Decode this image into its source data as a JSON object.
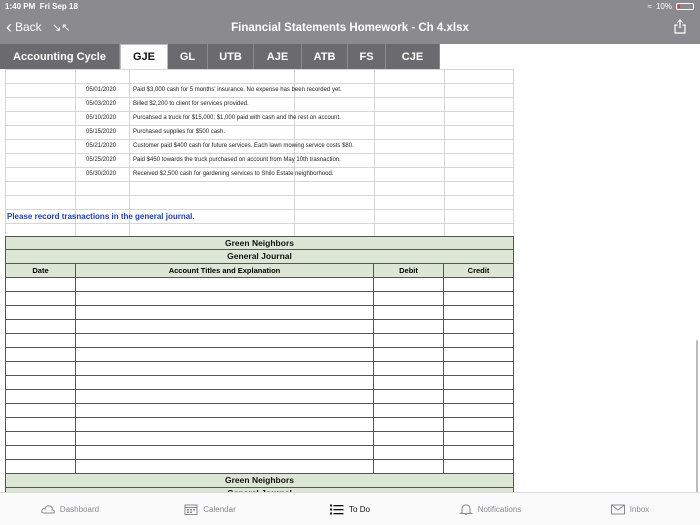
{
  "status": {
    "time": "1:40 PM",
    "date": "Fri Sep 18",
    "battery": "10%"
  },
  "nav": {
    "back_label": "Back",
    "title": "Financial Statements Homework - Ch 4.xlsx"
  },
  "tabs": [
    {
      "label": "Accounting Cycle",
      "active": false
    },
    {
      "label": "GJE",
      "active": true
    },
    {
      "label": "GL",
      "active": false
    },
    {
      "label": "UTB",
      "active": false
    },
    {
      "label": "AJE",
      "active": false
    },
    {
      "label": "ATB",
      "active": false
    },
    {
      "label": "FS",
      "active": false
    },
    {
      "label": "CJE",
      "active": false
    }
  ],
  "transactions": [
    {
      "date": "05/01/2020",
      "description": "Paid $3,000 cash for 5 months' insurance. No expense has been recorded yet."
    },
    {
      "date": "05/03/2020",
      "description": "Billed $2,200 to client for services provided."
    },
    {
      "date": "05/10/2020",
      "description": "Purcahsed a truck for $15,000; $1,000 paid with cash and the rest on account."
    },
    {
      "date": "05/15/2020",
      "description": "Purchased supplies for $500 cash."
    },
    {
      "date": "05/21/2020",
      "description": "Customer paid $400 cash for future services. Each lawn mowing service costs $80."
    },
    {
      "date": "05/25/2020",
      "description": "Paid $450 towards the truck purchased on account from May 10th trasnaction."
    },
    {
      "date": "05/30/2020",
      "description": "Received $2,500 cash for gardening services to Shilo Estate neighborhood."
    }
  ],
  "instruction": "Please record trasnactions in the general journal.",
  "journal": {
    "company": "Green Neighbors",
    "subtitle": "General Journal",
    "columns": {
      "date": "Date",
      "account": "Account Titles and Explanation",
      "debit": "Debit",
      "credit": "Credit"
    }
  },
  "bottom_tabs": [
    {
      "label": "Dashboard",
      "icon": "cloud-icon",
      "active": false
    },
    {
      "label": "Calendar",
      "icon": "calendar-icon",
      "active": false
    },
    {
      "label": "To Do",
      "icon": "list-icon",
      "active": true
    },
    {
      "label": "Notifications",
      "icon": "bell-icon",
      "active": false
    },
    {
      "label": "Inbox",
      "icon": "mail-icon",
      "active": false
    }
  ]
}
